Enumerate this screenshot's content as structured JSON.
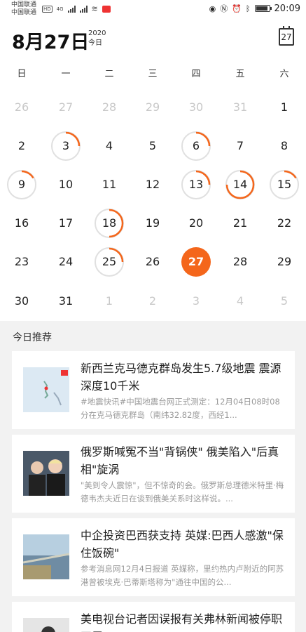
{
  "status_bar": {
    "carrier1": "中国联通",
    "carrier2": "中国联通",
    "network": "4G",
    "time": "20:09"
  },
  "header": {
    "date": "8月27日",
    "year": "2020",
    "today_label": "今日",
    "calendar_icon_day": "27"
  },
  "weekdays": [
    "日",
    "一",
    "二",
    "三",
    "四",
    "五",
    "六"
  ],
  "days": [
    [
      "26",
      "27",
      "28",
      "29",
      "30",
      "31",
      "1"
    ],
    [
      "2",
      "3",
      "4",
      "5",
      "6",
      "7",
      "8"
    ],
    [
      "9",
      "10",
      "11",
      "12",
      "13",
      "14",
      "15"
    ],
    [
      "16",
      "17",
      "18",
      "19",
      "20",
      "21",
      "22"
    ],
    [
      "23",
      "24",
      "25",
      "26",
      "27",
      "28",
      "29"
    ],
    [
      "30",
      "31",
      "1",
      "2",
      "3",
      "4",
      "5"
    ]
  ],
  "recommendations_title": "今日推荐",
  "articles": [
    {
      "headline": "新西兰克马德克群岛发生5.7级地震 震源深度10千米",
      "summary": "#地震快讯#中国地震台网正式测定：12月04日08时08分在克马德克群岛（南纬32.82度，西经1..."
    },
    {
      "headline": "俄罗斯喊冤不当\"背锅侠\" 俄美陷入\"后真相\"旋涡",
      "summary": "\"美到令人震惊\"，但不惊奇的会。俄罗斯总理德米特里·梅德韦杰夫近日在谈到俄美关系时这样说。..."
    },
    {
      "headline": "中企投资巴西获支持 英媒:巴西人感激\"保住饭碗\"",
      "summary": "参考消息网12月4日报道 英媒称，里约热内卢附近的阿苏港曾被埃克·巴蒂斯塔称为\"通往中国的公..."
    },
    {
      "headline": "美电视台记者因误报有关弗林新闻被停职四周",
      "summary": ""
    }
  ],
  "colors": {
    "accent": "#f4661b",
    "ring": "#e0e0e0"
  }
}
